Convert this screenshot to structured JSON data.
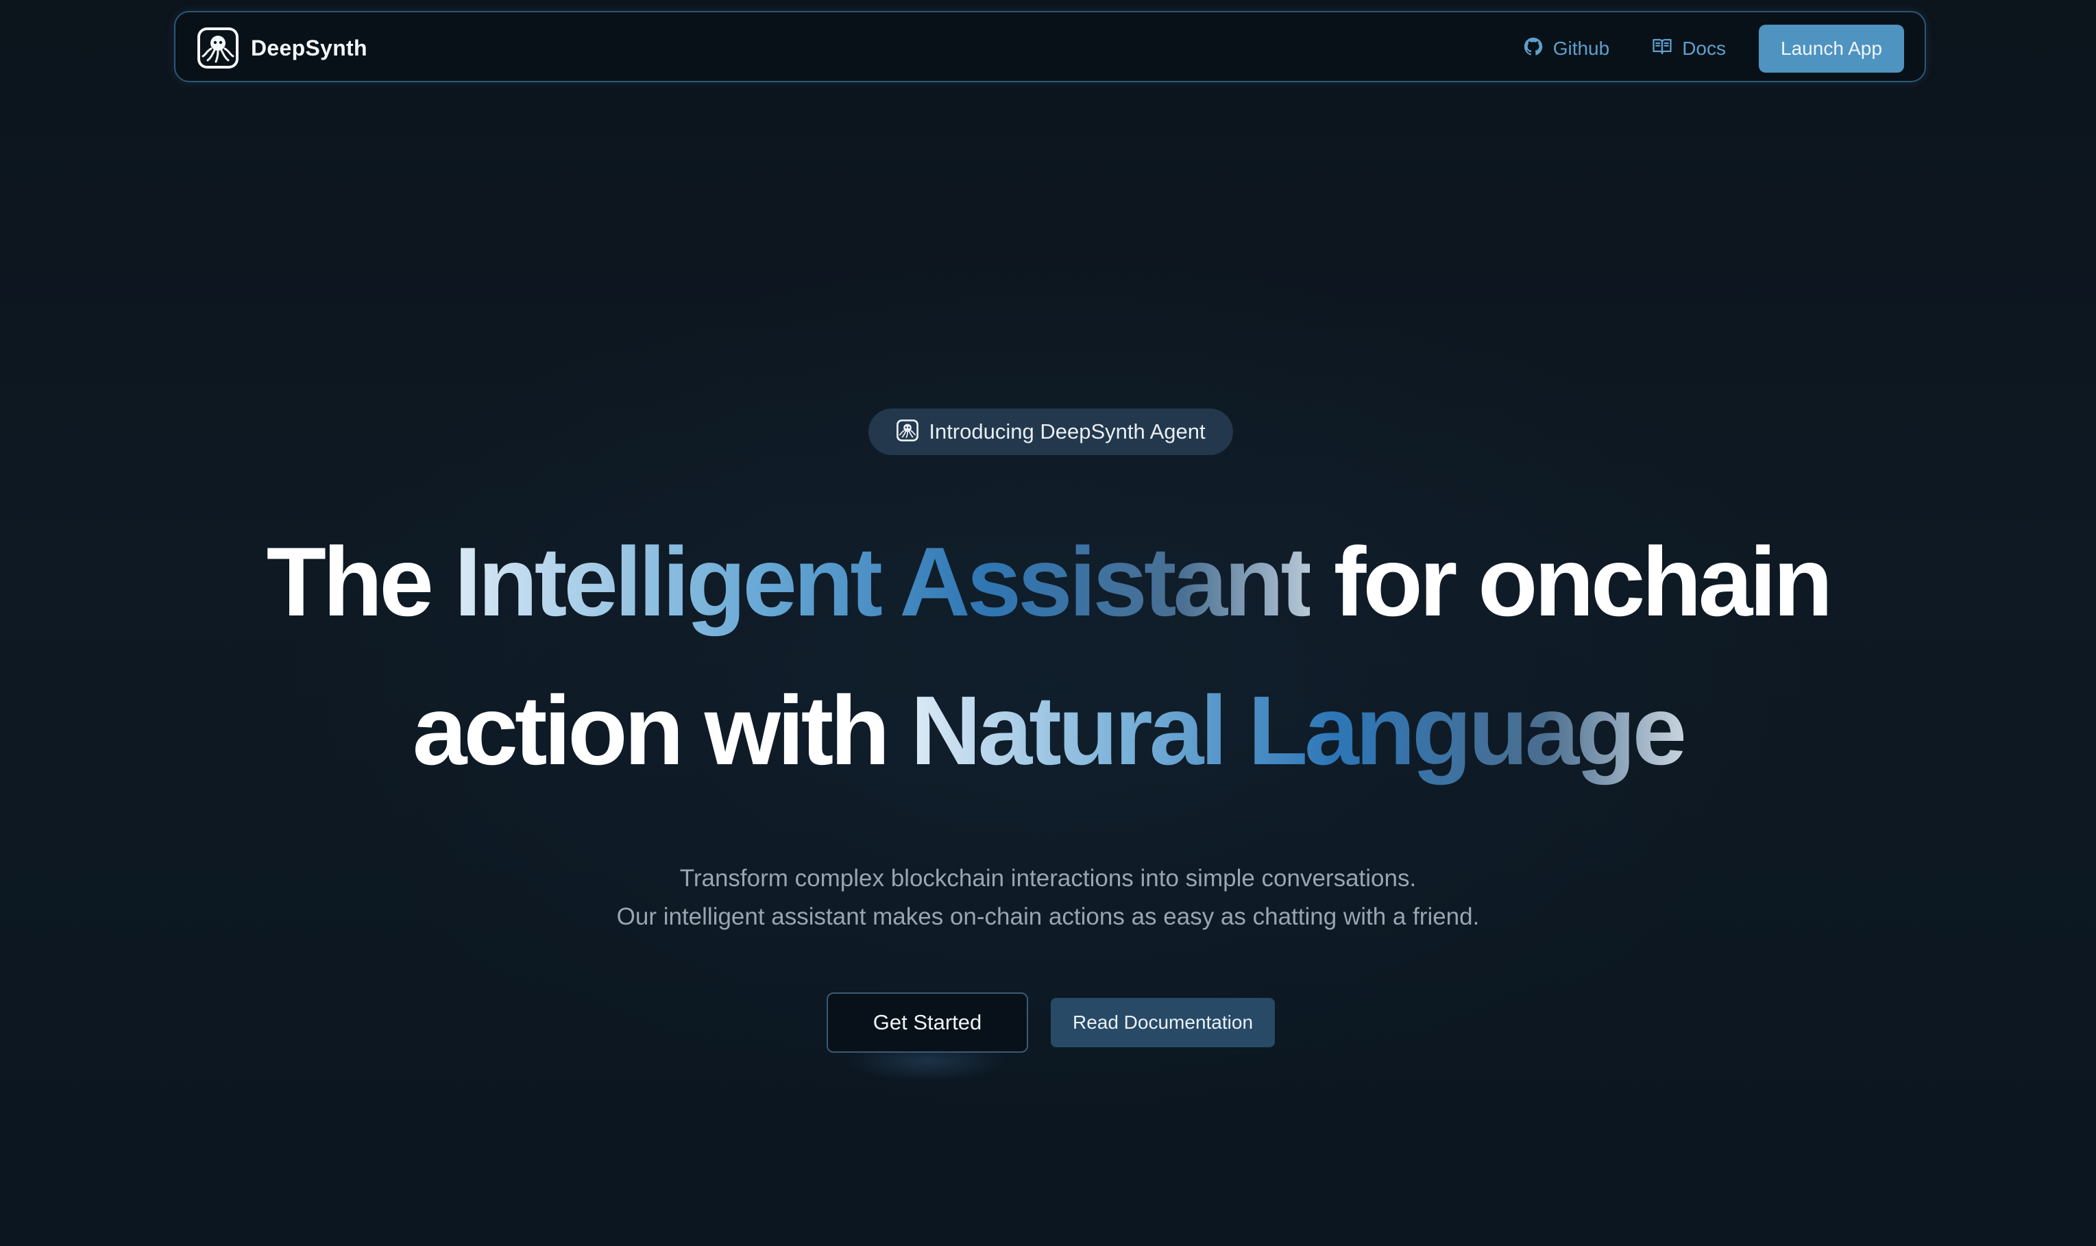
{
  "navbar": {
    "brand_name": "DeepSynth",
    "links": {
      "github": "Github",
      "docs": "Docs"
    },
    "launch_button": "Launch App"
  },
  "hero": {
    "badge": "Introducing DeepSynth Agent",
    "headline": {
      "line1": {
        "word1": "The",
        "highlight1": "Intelligent Assistant",
        "rest": "for onchain"
      },
      "line2": {
        "prefix": "action with",
        "highlight2": "Natural Language"
      }
    },
    "subtext": {
      "line1": "Transform complex blockchain interactions into simple conversations.",
      "line2": "Our intelligent assistant makes on-chain actions as easy as chatting with a friend."
    },
    "buttons": {
      "get_started": "Get Started",
      "read_documentation": "Read Documentation"
    }
  },
  "icons": {
    "brand": "octopus-logo-icon",
    "github": "github-icon",
    "docs": "book-open-icon",
    "badge": "octopus-logo-icon"
  },
  "colors": {
    "background": "#0e1923",
    "accent": "#4f93c0",
    "nav_link": "#5fa0cd",
    "badge_bg": "#23384d",
    "secondary_button": "#284a66",
    "navbar_border": "#2a5878",
    "subtext": "#9aa5b1"
  }
}
